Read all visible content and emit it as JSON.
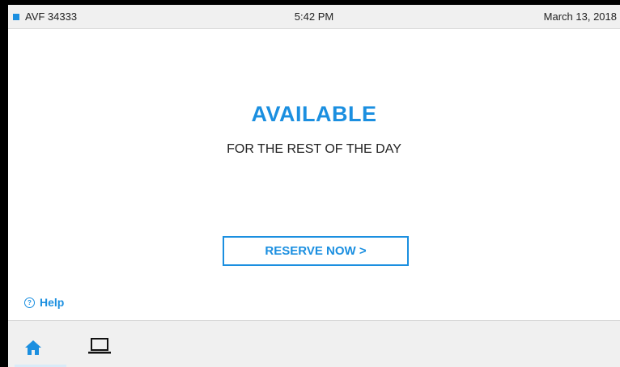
{
  "status_bar": {
    "room_id": "AVF 34333",
    "time": "5:42 PM",
    "date": "March 13, 2018"
  },
  "availability": {
    "status": "AVAILABLE",
    "detail": "FOR THE REST OF THE DAY"
  },
  "actions": {
    "reserve_label": "RESERVE NOW >",
    "help_label": "Help",
    "help_icon_glyph": "?"
  },
  "nav": {
    "items": [
      {
        "icon": "home-icon",
        "active": true
      },
      {
        "icon": "laptop-icon",
        "active": false
      }
    ]
  },
  "colors": {
    "accent": "#1b8fe0",
    "bar_background": "#f0f0f0"
  }
}
